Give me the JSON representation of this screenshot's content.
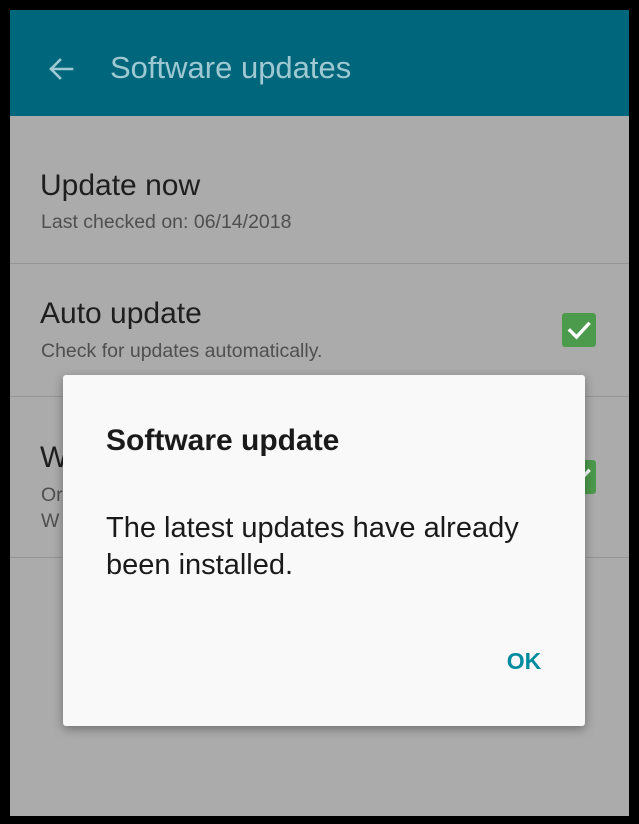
{
  "app_bar": {
    "back_icon": "arrow-left-icon",
    "title": "Software updates"
  },
  "settings": {
    "update_now": {
      "title": "Update now",
      "subtitle": "Last checked on: 06/14/2018"
    },
    "auto_update": {
      "title": "Auto update",
      "subtitle": "Check for updates automatically.",
      "checked": true
    },
    "wifi_only": {
      "title_visible": "W",
      "subtitle_line1_visible": "Or",
      "subtitle_line2_visible": "W",
      "checked": true
    }
  },
  "dialog": {
    "title": "Software update",
    "message": "The latest updates have already been installed.",
    "ok_label": "OK"
  },
  "colors": {
    "app_bar": "#00667c",
    "app_bar_text": "#9fc9d2",
    "background_dimmed": "#ababab",
    "checkbox": "#4c9a4c",
    "dialog_background": "#f9f9f9",
    "dialog_button": "#008b9e"
  }
}
